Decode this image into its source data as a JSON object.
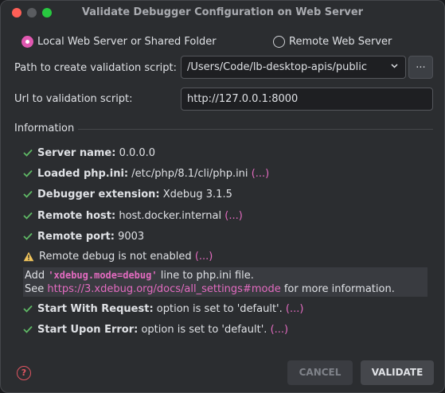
{
  "window": {
    "title": "Validate Debugger Configuration on Web Server"
  },
  "mode": {
    "local_label": "Local Web Server or Shared Folder",
    "remote_label": "Remote Web Server",
    "selected": "local"
  },
  "form": {
    "path_label": "Path to create validation script:",
    "path_value": "/Users/Code/lb-desktop-apis/public",
    "browse_label": "...",
    "url_label": "Url to validation script:",
    "url_value": "http://127.0.0.1:8000"
  },
  "information": {
    "title": "Information",
    "server_name": {
      "label": "Server name:",
      "value": "0.0.0.0"
    },
    "loaded_phpini": {
      "label": "Loaded php.ini:",
      "value": "/etc/php/8.1/cli/php.ini",
      "more": "(...)"
    },
    "debugger_extension": {
      "label": "Debugger extension:",
      "value": "Xdebug 3.1.5"
    },
    "remote_host": {
      "label": "Remote host:",
      "value": "host.docker.internal",
      "more": "(...)"
    },
    "remote_port": {
      "label": "Remote port:",
      "value": "9003"
    },
    "remote_debug_warning": {
      "text": "Remote debug is not enabled",
      "more": "(...)"
    },
    "notice": {
      "add": "Add",
      "code": "'xdebug.mode=debug'",
      "line1_suffix": "line to php.ini file.",
      "see": "See",
      "link": "https://3.xdebug.org/docs/all_settings#mode",
      "line2_suffix": "for more information."
    },
    "start_with_request": {
      "label": "Start With Request:",
      "value": "option is set to 'default'.",
      "more": "(...)"
    },
    "start_upon_error": {
      "label": "Start Upon Error:",
      "value": "option is set to 'default'.",
      "more": "(...)"
    }
  },
  "footer": {
    "help_icon": "?",
    "cancel_label": "CANCEL",
    "validate_label": "VALIDATE"
  },
  "colors": {
    "accent": "#e058b0",
    "link": "#e36bc0",
    "check": "#5fb865",
    "warning": "#f2c55c",
    "help": "#e05561"
  }
}
